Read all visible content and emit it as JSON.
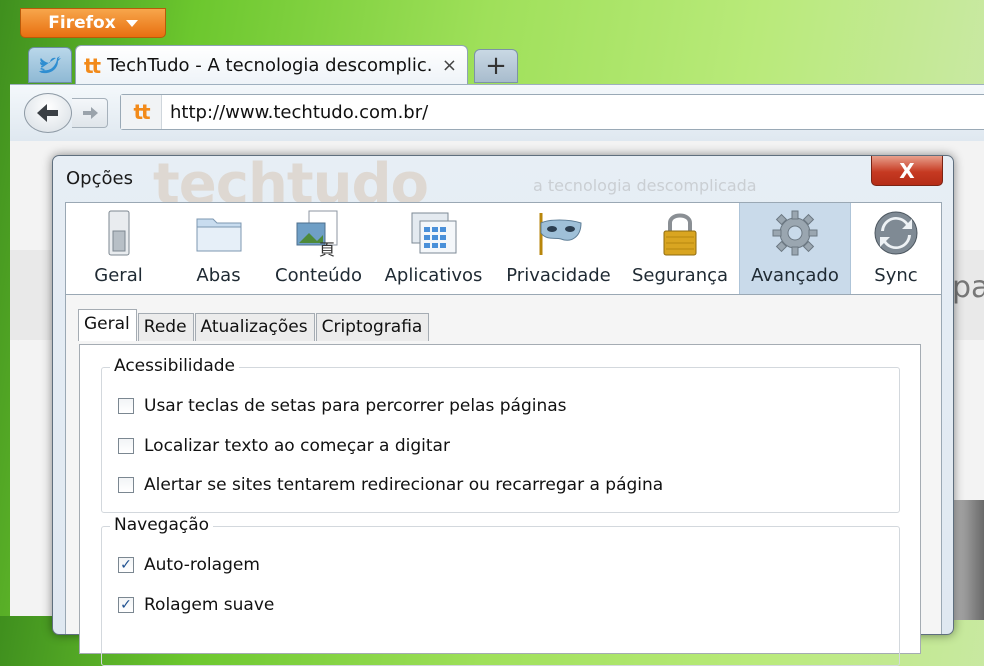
{
  "browser": {
    "menu_button_label": "Firefox",
    "tabs": [
      {
        "icon": "twitter-icon",
        "pinned": true
      },
      {
        "icon": "techtudo-favicon",
        "title": "TechTudo - A tecnologia descomplic...",
        "close": "×"
      }
    ],
    "new_tab_label": "+",
    "url": "http://www.techtudo.com.br/",
    "site_logo_text": "tt"
  },
  "page": {
    "edge_text": "pad"
  },
  "dialog": {
    "title": "Opções",
    "close_label": "X",
    "watermark_text": "techtudo",
    "watermark_tagline": "a tecnologia descomplicada",
    "panes": [
      {
        "label": "Geral",
        "icon": "general-switch-icon"
      },
      {
        "label": "Abas",
        "icon": "tabs-folder-icon"
      },
      {
        "label": "Conteúdo",
        "icon": "content-icon"
      },
      {
        "label": "Aplicativos",
        "icon": "applications-icon"
      },
      {
        "label": "Privacidade",
        "icon": "privacy-mask-icon"
      },
      {
        "label": "Segurança",
        "icon": "security-lock-icon"
      },
      {
        "label": "Avançado",
        "icon": "advanced-gear-icon",
        "selected": true
      },
      {
        "label": "Sync",
        "icon": "sync-icon"
      }
    ],
    "subtabs": [
      {
        "label": "Geral",
        "active": true
      },
      {
        "label": "Rede"
      },
      {
        "label": "Atualizações"
      },
      {
        "label": "Criptografia"
      }
    ],
    "groups": {
      "accessibility": {
        "legend": "Acessibilidade",
        "options": [
          {
            "label": "Usar teclas de setas para percorrer pelas páginas",
            "checked": false
          },
          {
            "label": "Localizar texto ao começar a digitar",
            "checked": false
          },
          {
            "label": "Alertar se sites tentarem redirecionar ou recarregar a página",
            "checked": false
          }
        ]
      },
      "navigation": {
        "legend": "Navegação",
        "options": [
          {
            "label": "Auto-rolagem",
            "checked": true
          },
          {
            "label": "Rolagem suave",
            "checked": true
          }
        ]
      }
    },
    "check_mark": "✓"
  }
}
